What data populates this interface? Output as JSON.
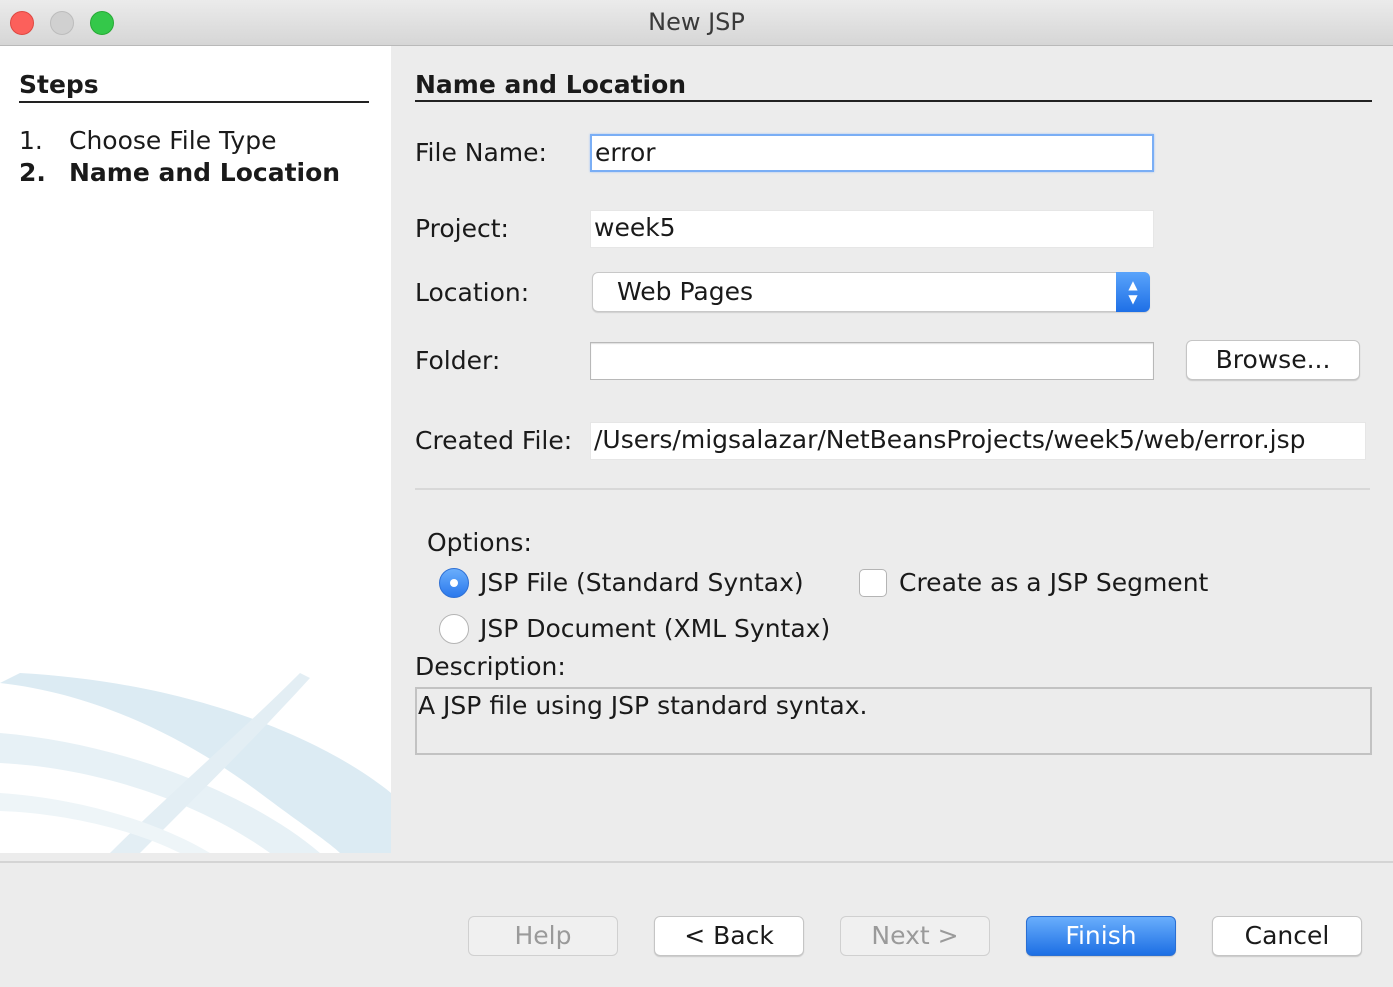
{
  "window": {
    "title": "New JSP"
  },
  "steps": {
    "heading": "Steps",
    "items": [
      {
        "number": "1.",
        "label": "Choose File Type",
        "current": false
      },
      {
        "number": "2.",
        "label": "Name and Location",
        "current": true
      }
    ]
  },
  "form": {
    "heading": "Name and Location",
    "file_name_label": "File Name:",
    "file_name_value": "error",
    "project_label": "Project:",
    "project_value": "week5",
    "location_label": "Location:",
    "location_value": "Web Pages",
    "folder_label": "Folder:",
    "folder_value": "",
    "browse_label": "Browse...",
    "created_file_label": "Created File:",
    "created_file_value": "/Users/migsalazar/NetBeansProjects/week5/web/error.jsp"
  },
  "options": {
    "label": "Options:",
    "radio_standard": "JSP File (Standard Syntax)",
    "radio_standard_selected": true,
    "radio_xml": "JSP Document (XML Syntax)",
    "radio_xml_selected": false,
    "segment_checkbox": "Create as a JSP Segment",
    "segment_checked": false
  },
  "description": {
    "label": "Description:",
    "text": "A JSP file using JSP standard syntax."
  },
  "buttons": {
    "help": "Help",
    "back": "< Back",
    "next": "Next >",
    "finish": "Finish",
    "cancel": "Cancel"
  },
  "colors": {
    "accent": "#1d6fe4",
    "window_bg": "#ececec",
    "sidebar_bg": "#ffffff"
  }
}
